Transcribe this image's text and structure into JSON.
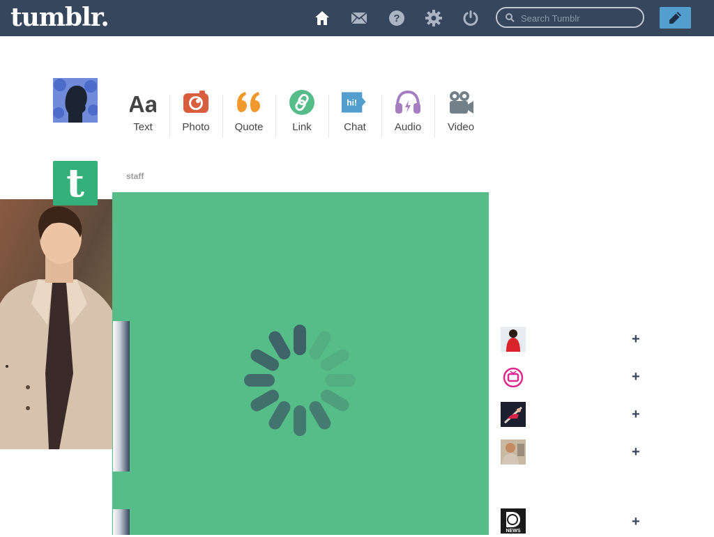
{
  "header": {
    "logo": "tumblr.",
    "search": {
      "placeholder": "Search Tumblr"
    },
    "nav": [
      "home-icon",
      "mail-icon",
      "help-icon",
      "gear-icon",
      "power-icon"
    ],
    "compose_icon": "pencil-icon",
    "background": "#36465d"
  },
  "post_types": [
    {
      "label": "Text",
      "icon": "text-icon",
      "color": "#444444"
    },
    {
      "label": "Photo",
      "icon": "camera-icon",
      "color": "#d95e40"
    },
    {
      "label": "Quote",
      "icon": "quote-icon",
      "color": "#f2992e"
    },
    {
      "label": "Link",
      "icon": "link-icon",
      "color": "#56bc8a"
    },
    {
      "label": "Chat",
      "icon": "chat-icon",
      "color": "#529ecc"
    },
    {
      "label": "Audio",
      "icon": "headphones-icon",
      "color": "#a77dc2"
    },
    {
      "label": "Video",
      "icon": "video-camera-icon",
      "color": "#748089"
    }
  ],
  "post": {
    "author": "staff",
    "avatar_letter": "t",
    "card_color": "#57bd88",
    "state": "loading"
  },
  "recommended": [
    {
      "avatar": "red-hoodie-avatar",
      "follow": "+"
    },
    {
      "avatar": "tv-logo-avatar",
      "follow": "+"
    },
    {
      "avatar": "skater-avatar",
      "follow": "+"
    },
    {
      "avatar": "man-avatar",
      "follow": "+"
    },
    {
      "avatar": "discovery-news-avatar",
      "follow": "+"
    }
  ]
}
